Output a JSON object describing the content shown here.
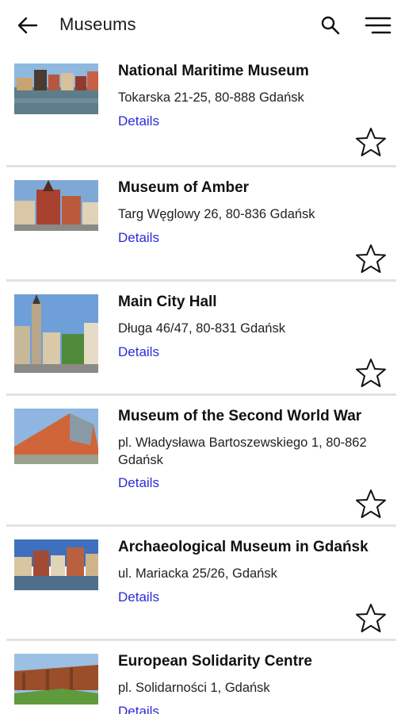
{
  "header": {
    "title": "Museums",
    "icons": [
      "back-arrow-icon",
      "search-icon",
      "menu-icon"
    ]
  },
  "museums": [
    {
      "name": "National Maritime Museum",
      "address": "Tokarska 21-25, 80-888 Gdańsk",
      "details_label": "Details"
    },
    {
      "name": "Museum of Amber",
      "address": "Targ Węglowy 26, 80-836 Gdańsk",
      "details_label": "Details"
    },
    {
      "name": "Main City Hall",
      "address": "Długa 46/47, 80-831 Gdańsk",
      "details_label": "Details"
    },
    {
      "name": "Museum of the Second World War",
      "address": "pl. Władysława Bartoszewskiego 1, 80-862 Gdańsk",
      "details_label": "Details"
    },
    {
      "name": "Archaeological Museum in Gdańsk",
      "address": "ul. Mariacka 25/26, Gdańsk",
      "details_label": "Details"
    },
    {
      "name": "European Solidarity Centre",
      "address": "pl. Solidarności 1, Gdańsk",
      "details_label": "Details"
    }
  ],
  "colors": {
    "link": "#2b2bd6",
    "divider": "#e2e2e2"
  }
}
